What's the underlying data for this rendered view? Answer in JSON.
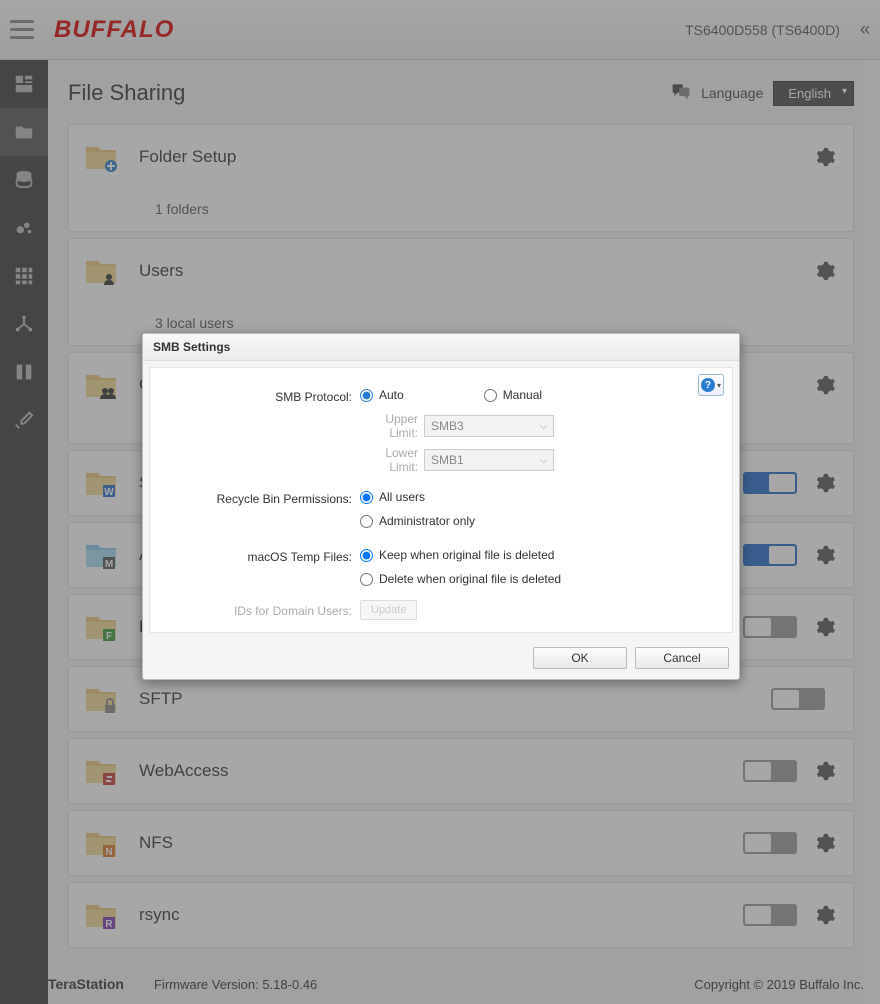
{
  "header": {
    "logo": "BUFFALO",
    "device": "TS6400D558 (TS6400D)"
  },
  "page": {
    "title": "File Sharing",
    "language_label": "Language",
    "language_value": "English"
  },
  "cards": {
    "folder_setup": {
      "title": "Folder Setup",
      "sub": "1 folders"
    },
    "users": {
      "title": "Users",
      "sub": "3 local users"
    },
    "groups": {
      "title": "G"
    },
    "smb": {
      "title": "S",
      "toggle": true
    },
    "afp": {
      "title": "A",
      "toggle": true
    },
    "ftp": {
      "title": "F",
      "toggle": false
    },
    "sftp": {
      "title": "SFTP",
      "toggle": false
    },
    "webaccess": {
      "title": "WebAccess",
      "toggle": false
    },
    "nfs": {
      "title": "NFS",
      "toggle": false
    },
    "rsync": {
      "title": "rsync",
      "toggle": false
    }
  },
  "footer": {
    "product": "TeraStation",
    "firmware": "Firmware Version: 5.18-0.46",
    "copyright": "Copyright © 2019 Buffalo Inc."
  },
  "dialog": {
    "title": "SMB Settings",
    "labels": {
      "protocol": "SMB Protocol:",
      "upper": "Upper Limit:",
      "lower": "Lower Limit:",
      "recycle": "Recycle Bin Permissions:",
      "macos": "macOS Temp Files:",
      "ids": "IDs for Domain Users:"
    },
    "protocol": {
      "auto": "Auto",
      "manual": "Manual",
      "selected": "auto",
      "upper_value": "SMB3",
      "lower_value": "SMB1"
    },
    "recycle": {
      "all": "All users",
      "admin": "Administrator only",
      "selected": "all"
    },
    "macos": {
      "keep": "Keep when original file is deleted",
      "delete": "Delete when original file is deleted",
      "selected": "keep"
    },
    "ids_button": "Update",
    "buttons": {
      "ok": "OK",
      "cancel": "Cancel"
    }
  }
}
